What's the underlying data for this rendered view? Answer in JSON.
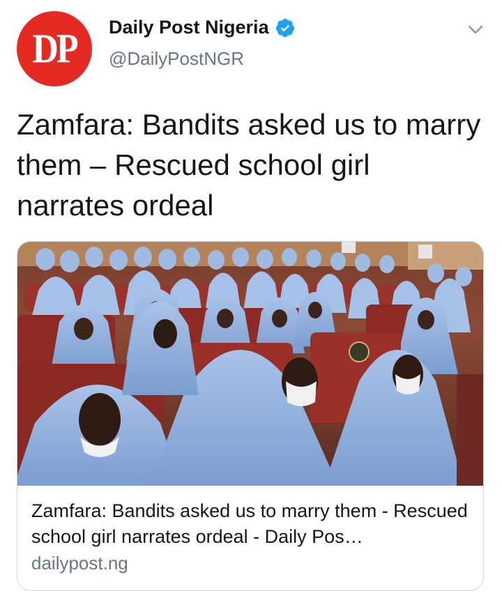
{
  "author": {
    "avatar_text": "DP",
    "display_name": "Daily Post Nigeria",
    "handle": "@DailyPostNGR",
    "verified": true
  },
  "tweet": {
    "text": "Zamfara: Bandits asked us to marry them – Rescued school girl narrates ordeal"
  },
  "card": {
    "image_alt": "photo",
    "title": "Zamfara: Bandits asked us to marry them - Rescued school girl narrates ordeal - Daily Pos…",
    "domain": "dailypost.ng"
  },
  "icons": {
    "verified": "verified-badge-icon",
    "menu": "chevron-down-icon"
  },
  "colors": {
    "brand_red": "#e42a22",
    "verified_blue": "#1da1f2",
    "secondary_text": "#657786",
    "hijab_blue": "#8fb0dc",
    "seat_red": "#8e2a25"
  }
}
